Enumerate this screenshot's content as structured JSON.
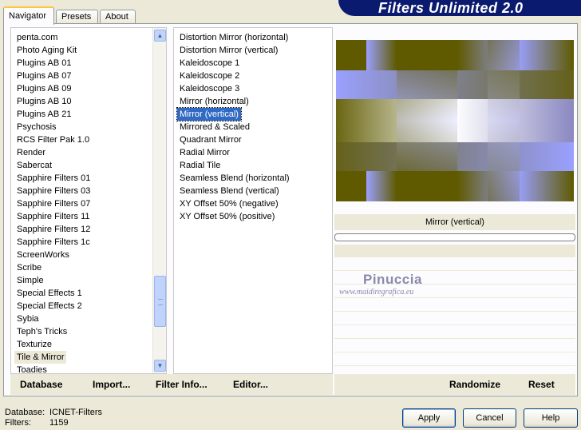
{
  "tabs": [
    {
      "label": "Navigator",
      "active": true
    },
    {
      "label": "Presets",
      "active": false
    },
    {
      "label": "About",
      "active": false
    }
  ],
  "app_title": "Filters Unlimited 2.0",
  "categories": [
    "penta.com",
    "Photo Aging Kit",
    "Plugins AB 01",
    "Plugins AB 07",
    "Plugins AB 09",
    "Plugins AB 10",
    "Plugins AB 21",
    "Psychosis",
    "RCS Filter Pak 1.0",
    "Render",
    "Sabercat",
    "Sapphire Filters 01",
    "Sapphire Filters 03",
    "Sapphire Filters 07",
    "Sapphire Filters 11",
    "Sapphire Filters 12",
    "Sapphire Filters 1c",
    "ScreenWorks",
    "Scribe",
    "Simple",
    "Special Effects 1",
    "Special Effects 2",
    "Sybia",
    "Teph's Tricks",
    "Texturize",
    "Tile & Mirror",
    "Toadies"
  ],
  "selected_category": "Tile & Mirror",
  "filters": [
    "Distortion Mirror (horizontal)",
    "Distortion Mirror (vertical)",
    "Kaleidoscope 1",
    "Kaleidoscope 2",
    "Kaleidoscope 3",
    "Mirror (horizontal)",
    "Mirror (vertical)",
    "Mirrored & Scaled",
    "Quadrant Mirror",
    "Radial Mirror",
    "Radial Tile",
    "Seamless Blend (horizontal)",
    "Seamless Blend (vertical)",
    "XY Offset 50% (negative)",
    "XY Offset 50% (positive)"
  ],
  "selected_filter": "Mirror (vertical)",
  "preview_caption": "Mirror (vertical)",
  "progress": 0,
  "watermark": {
    "line1": "Pinuccia",
    "line2": "www.maidiregrafica.eu"
  },
  "panel_buttons": {
    "database": "Database",
    "import": "Import...",
    "filter_info": "Filter Info...",
    "editor": "Editor...",
    "randomize": "Randomize",
    "reset": "Reset"
  },
  "footer": {
    "database_label": "Database:",
    "database_value": "ICNET-Filters",
    "filters_label": "Filters:",
    "filters_value": "1159"
  },
  "dialog_buttons": {
    "apply": "Apply",
    "cancel": "Cancel",
    "help": "Help"
  },
  "colors": {
    "banner": "#0a1a6e",
    "selection": "#316ac5",
    "preview_olive": "#5f5a00",
    "preview_blue": "#9aa0ff"
  }
}
